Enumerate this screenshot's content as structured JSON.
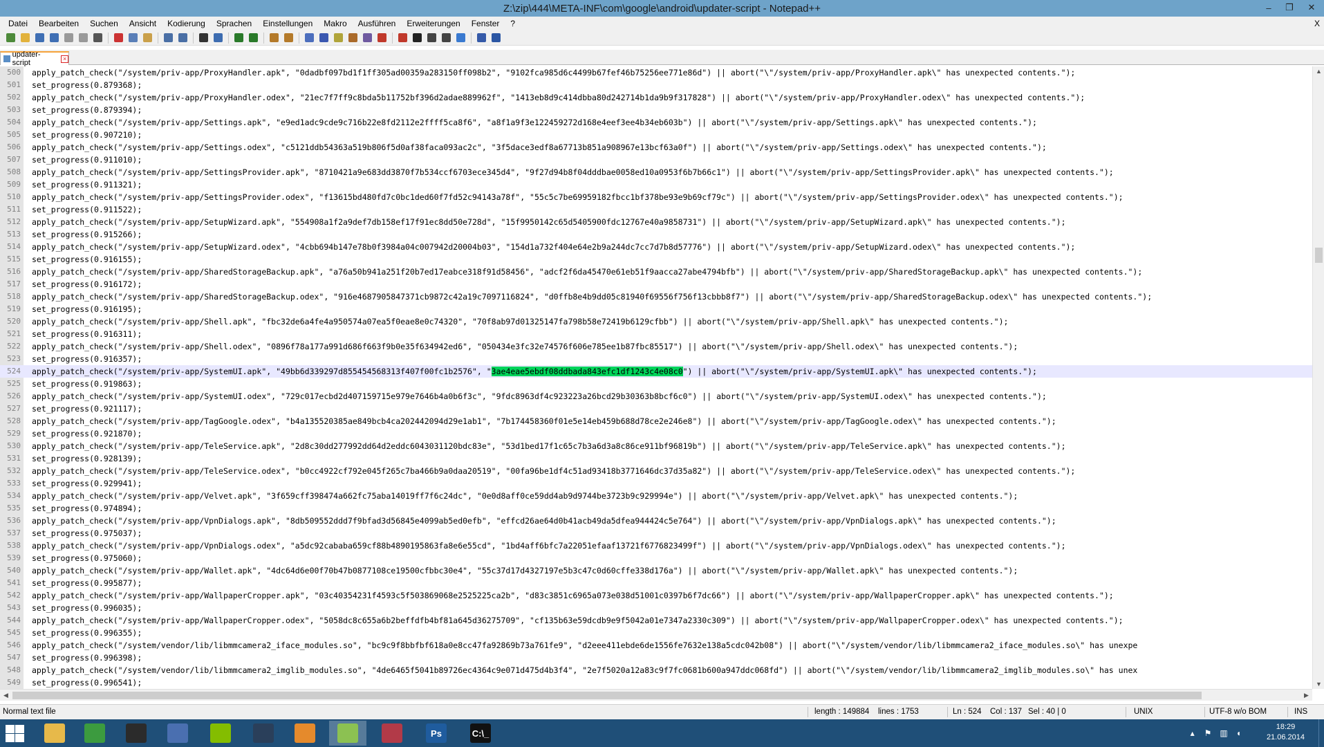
{
  "window": {
    "title": "Z:\\zip\\444\\META-INF\\com\\google\\android\\updater-script - Notepad++",
    "minimize_glyph": "–",
    "restore_glyph": "❐",
    "close_glyph": "✕"
  },
  "menu": [
    "Datei",
    "Bearbeiten",
    "Suchen",
    "Ansicht",
    "Kodierung",
    "Sprachen",
    "Einstellungen",
    "Makro",
    "Ausführen",
    "Erweiterungen",
    "Fenster",
    "?"
  ],
  "menu_close_doc": "X",
  "toolbar_icons": [
    "new-file",
    "open-file",
    "save",
    "save-all",
    "close",
    "close-all",
    "print",
    "cut",
    "copy",
    "paste",
    "undo",
    "redo",
    "find",
    "replace",
    "zoom-in",
    "zoom-out",
    "sync-v",
    "sync-h",
    "word-wrap",
    "show-all-chars",
    "indent-guide",
    "user-lang",
    "doc-map",
    "function-list",
    "macro-record",
    "macro-stop",
    "macro-play",
    "macro-play-multi",
    "macro-save",
    "spell-check",
    "spell-options"
  ],
  "tab": {
    "label": "updater-script"
  },
  "editor": {
    "lines": [
      {
        "n": "500",
        "code": "apply_patch_check(\"/system/priv-app/ProxyHandler.apk\", \"0dadbf097bd1f1ff305ad00359a283150ff098b2\", \"9102fca985d6c4499b67fef46b75256ee771e86d\") || abort(\"\\\"/system/priv-app/ProxyHandler.apk\\\" has unexpected contents.\");"
      },
      {
        "n": "501",
        "code": "set_progress(0.879368);"
      },
      {
        "n": "502",
        "code": "apply_patch_check(\"/system/priv-app/ProxyHandler.odex\", \"21ec7f7ff9c8bda5b11752bf396d2adae889962f\", \"1413eb8d9c414dbba80d242714b1da9b9f317828\") || abort(\"\\\"/system/priv-app/ProxyHandler.odex\\\" has unexpected contents.\");"
      },
      {
        "n": "503",
        "code": "set_progress(0.879394);"
      },
      {
        "n": "504",
        "code": "apply_patch_check(\"/system/priv-app/Settings.apk\", \"e9ed1adc9cde9c716b22e8fd2112e2ffff5ca8f6\", \"a8f1a9f3e122459272d168e4eef3ee4b34eb603b\") || abort(\"\\\"/system/priv-app/Settings.apk\\\" has unexpected contents.\");"
      },
      {
        "n": "505",
        "code": "set_progress(0.907210);"
      },
      {
        "n": "506",
        "code": "apply_patch_check(\"/system/priv-app/Settings.odex\", \"c5121ddb54363a519b806f5d0af38faca093ac2c\", \"3f5dace3edf8a67713b851a908967e13bcf63a0f\") || abort(\"\\\"/system/priv-app/Settings.odex\\\" has unexpected contents.\");"
      },
      {
        "n": "507",
        "code": "set_progress(0.911010);"
      },
      {
        "n": "508",
        "code": "apply_patch_check(\"/system/priv-app/SettingsProvider.apk\", \"8710421a9e683dd3870f7b534ccf6703ece345d4\", \"9f27d94b8f04dddbae0058ed10a0953f6b7b66c1\") || abort(\"\\\"/system/priv-app/SettingsProvider.apk\\\" has unexpected contents.\");"
      },
      {
        "n": "509",
        "code": "set_progress(0.911321);"
      },
      {
        "n": "510",
        "code": "apply_patch_check(\"/system/priv-app/SettingsProvider.odex\", \"f13615bd480fd7c0bc1ded60f7fd52c94143a78f\", \"55c5c7be69959182fbcc1bf378be93e9b69cf79c\") || abort(\"\\\"/system/priv-app/SettingsProvider.odex\\\" has unexpected contents.\");"
      },
      {
        "n": "511",
        "code": "set_progress(0.911522);"
      },
      {
        "n": "512",
        "code": "apply_patch_check(\"/system/priv-app/SetupWizard.apk\", \"554908a1f2a9def7db158ef17f91ec8dd50e728d\", \"15f9950142c65d5405900fdc12767e40a9858731\") || abort(\"\\\"/system/priv-app/SetupWizard.apk\\\" has unexpected contents.\");"
      },
      {
        "n": "513",
        "code": "set_progress(0.915266);"
      },
      {
        "n": "514",
        "code": "apply_patch_check(\"/system/priv-app/SetupWizard.odex\", \"4cbb694b147e78b0f3984a04c007942d20004b03\", \"154d1a732f404e64e2b9a244dc7cc7d7b8d57776\") || abort(\"\\\"/system/priv-app/SetupWizard.odex\\\" has unexpected contents.\");"
      },
      {
        "n": "515",
        "code": "set_progress(0.916155);"
      },
      {
        "n": "516",
        "code": "apply_patch_check(\"/system/priv-app/SharedStorageBackup.apk\", \"a76a50b941a251f20b7ed17eabce318f91d58456\", \"adcf2f6da45470e61eb51f9aacca27abe4794bfb\") || abort(\"\\\"/system/priv-app/SharedStorageBackup.apk\\\" has unexpected contents.\");"
      },
      {
        "n": "517",
        "code": "set_progress(0.916172);"
      },
      {
        "n": "518",
        "code": "apply_patch_check(\"/system/priv-app/SharedStorageBackup.odex\", \"916e4687905847371cb9872c42a19c7097116824\", \"d0ffb8e4b9dd05c81940f69556f756f13cbbb8f7\") || abort(\"\\\"/system/priv-app/SharedStorageBackup.odex\\\" has unexpected contents.\");"
      },
      {
        "n": "519",
        "code": "set_progress(0.916195);"
      },
      {
        "n": "520",
        "code": "apply_patch_check(\"/system/priv-app/Shell.apk\", \"fbc32de6a4fe4a950574a07ea5f0eae8e0c74320\", \"70f8ab97d01325147fa798b58e72419b6129cfbb\") || abort(\"\\\"/system/priv-app/Shell.apk\\\" has unexpected contents.\");"
      },
      {
        "n": "521",
        "code": "set_progress(0.916311);"
      },
      {
        "n": "522",
        "code": "apply_patch_check(\"/system/priv-app/Shell.odex\", \"0896f78a177a991d686f663f9b0e35f634942ed6\", \"050434e3fc32e74576f606e785ee1b87fbc85517\") || abort(\"\\\"/system/priv-app/Shell.odex\\\" has unexpected contents.\");"
      },
      {
        "n": "523",
        "code": "set_progress(0.916357);"
      },
      {
        "n": "524",
        "pre": "apply_patch_check(\"/system/priv-app/SystemUI.apk\", \"49bb6d339297d855454568313f407f00fc1b2576\", \"",
        "sel": "3ae4eae5ebdf08ddbada843efc1df1243c4e08c0",
        "post": "\") || abort(\"\\\"/system/priv-app/SystemUI.apk\\\" has unexpected contents.\");"
      },
      {
        "n": "525",
        "code": "set_progress(0.919863);"
      },
      {
        "n": "526",
        "code": "apply_patch_check(\"/system/priv-app/SystemUI.odex\", \"729c017ecbd2d407159715e979e7646b4a0b6f3c\", \"9fdc8963df4c923223a26bcd29b30363b8bcf6c0\") || abort(\"\\\"/system/priv-app/SystemUI.odex\\\" has unexpected contents.\");"
      },
      {
        "n": "527",
        "code": "set_progress(0.921117);"
      },
      {
        "n": "528",
        "code": "apply_patch_check(\"/system/priv-app/TagGoogle.odex\", \"b4a135520385ae849bcb4ca202442094d29e1ab1\", \"7b174458360f01e5e14eb459b688d78ce2e246e8\") || abort(\"\\\"/system/priv-app/TagGoogle.odex\\\" has unexpected contents.\");"
      },
      {
        "n": "529",
        "code": "set_progress(0.921870);"
      },
      {
        "n": "530",
        "code": "apply_patch_check(\"/system/priv-app/TeleService.apk\", \"2d8c30dd277992dd64d2eddc6043031120bdc83e\", \"53d1bed17f1c65c7b3a6d3a8c86ce911bf96819b\") || abort(\"\\\"/system/priv-app/TeleService.apk\\\" has unexpected contents.\");"
      },
      {
        "n": "531",
        "code": "set_progress(0.928139);"
      },
      {
        "n": "532",
        "code": "apply_patch_check(\"/system/priv-app/TeleService.odex\", \"b0cc4922cf792e045f265c7ba466b9a0daa20519\", \"00fa96be1df4c51ad93418b3771646dc37d35a82\") || abort(\"\\\"/system/priv-app/TeleService.odex\\\" has unexpected contents.\");"
      },
      {
        "n": "533",
        "code": "set_progress(0.929941);"
      },
      {
        "n": "534",
        "code": "apply_patch_check(\"/system/priv-app/Velvet.apk\", \"3f659cff398474a662fc75aba14019ff7f6c24dc\", \"0e0d8aff0ce59dd4ab9d9744be3723b9c929994e\") || abort(\"\\\"/system/priv-app/Velvet.apk\\\" has unexpected contents.\");"
      },
      {
        "n": "535",
        "code": "set_progress(0.974894);"
      },
      {
        "n": "536",
        "code": "apply_patch_check(\"/system/priv-app/VpnDialogs.apk\", \"8db509552ddd7f9bfad3d56845e4099ab5ed0efb\", \"effcd26ae64d0b41acb49da5dfea944424c5e764\") || abort(\"\\\"/system/priv-app/VpnDialogs.apk\\\" has unexpected contents.\");"
      },
      {
        "n": "537",
        "code": "set_progress(0.975037);"
      },
      {
        "n": "538",
        "code": "apply_patch_check(\"/system/priv-app/VpnDialogs.odex\", \"a5dc92cababa659cf88b4890195863fa8e6e55cd\", \"1bd4aff6bfc7a22051efaaf13721f6776823499f\") || abort(\"\\\"/system/priv-app/VpnDialogs.odex\\\" has unexpected contents.\");"
      },
      {
        "n": "539",
        "code": "set_progress(0.975060);"
      },
      {
        "n": "540",
        "code": "apply_patch_check(\"/system/priv-app/Wallet.apk\", \"4dc64d6e00f70b47b0877108ce19500cfbbc30e4\", \"55c37d17d4327197e5b3c47c0d60cffe338d176a\") || abort(\"\\\"/system/priv-app/Wallet.apk\\\" has unexpected contents.\");"
      },
      {
        "n": "541",
        "code": "set_progress(0.995877);"
      },
      {
        "n": "542",
        "code": "apply_patch_check(\"/system/priv-app/WallpaperCropper.apk\", \"03c40354231f4593c5f503869068e2525225ca2b\", \"d83c3851c6965a073e038d51001c0397b6f7dc66\") || abort(\"\\\"/system/priv-app/WallpaperCropper.apk\\\" has unexpected contents.\");"
      },
      {
        "n": "543",
        "code": "set_progress(0.996035);"
      },
      {
        "n": "544",
        "code": "apply_patch_check(\"/system/priv-app/WallpaperCropper.odex\", \"5058dc8c655a6b2beffdfb4bf81a645d36275709\", \"cf135b63e59dcdb9e9f5042a01e7347a2330c309\") || abort(\"\\\"/system/priv-app/WallpaperCropper.odex\\\" has unexpected contents.\");"
      },
      {
        "n": "545",
        "code": "set_progress(0.996355);"
      },
      {
        "n": "546",
        "code": "apply_patch_check(\"/system/vendor/lib/libmmcamera2_iface_modules.so\", \"bc9c9f8bbfbf618a0e8cc47fa92869b73a761fe9\", \"d2eee411ebde6de1556fe7632e138a5cdc042b08\") || abort(\"\\\"/system/vendor/lib/libmmcamera2_iface_modules.so\\\" has unexpe"
      },
      {
        "n": "547",
        "code": "set_progress(0.996398);"
      },
      {
        "n": "548",
        "code": "apply_patch_check(\"/system/vendor/lib/libmmcamera2_imglib_modules.so\", \"4de6465f5041b89726ec4364c9e071d475d4b3f4\", \"2e7f5020a12a83c9f7fc0681b600a947ddc068fd\") || abort(\"\\\"/system/vendor/lib/libmmcamera2_imglib_modules.so\\\" has unex"
      },
      {
        "n": "549",
        "code": "set_progress(0.996541);"
      }
    ]
  },
  "status": {
    "file_type": "Normal text file",
    "length": "length : 149884",
    "lines": "lines : 1753",
    "ln": "Ln : 524",
    "col": "Col : 137",
    "sel": "Sel : 40 | 0",
    "eol": "UNIX",
    "encoding": "UTF-8 w/o BOM",
    "mode": "INS"
  },
  "taskbar": {
    "apps": [
      {
        "name": "file-explorer",
        "label": "",
        "color": "#e7b94a"
      },
      {
        "name": "chrome",
        "label": "",
        "color": "#3c9b3f"
      },
      {
        "name": "terminal",
        "label": "",
        "color": "#2b2b2b"
      },
      {
        "name": "network-tool",
        "label": "",
        "color": "#4a6fb0"
      },
      {
        "name": "spotify",
        "label": "",
        "color": "#84bd00"
      },
      {
        "name": "steam",
        "label": "",
        "color": "#2a3f5a"
      },
      {
        "name": "media-player",
        "label": "",
        "color": "#e58a2c"
      },
      {
        "name": "notepadpp",
        "label": "",
        "color": "#8cc152"
      },
      {
        "name": "paint-tool",
        "label": "",
        "color": "#b23a48"
      },
      {
        "name": "photoshop",
        "label": "Ps",
        "color": "#1f5c9e"
      },
      {
        "name": "cmd",
        "label": "C:\\_",
        "color": "#111111"
      }
    ],
    "time": "18:29",
    "date": "21.06.2014"
  }
}
